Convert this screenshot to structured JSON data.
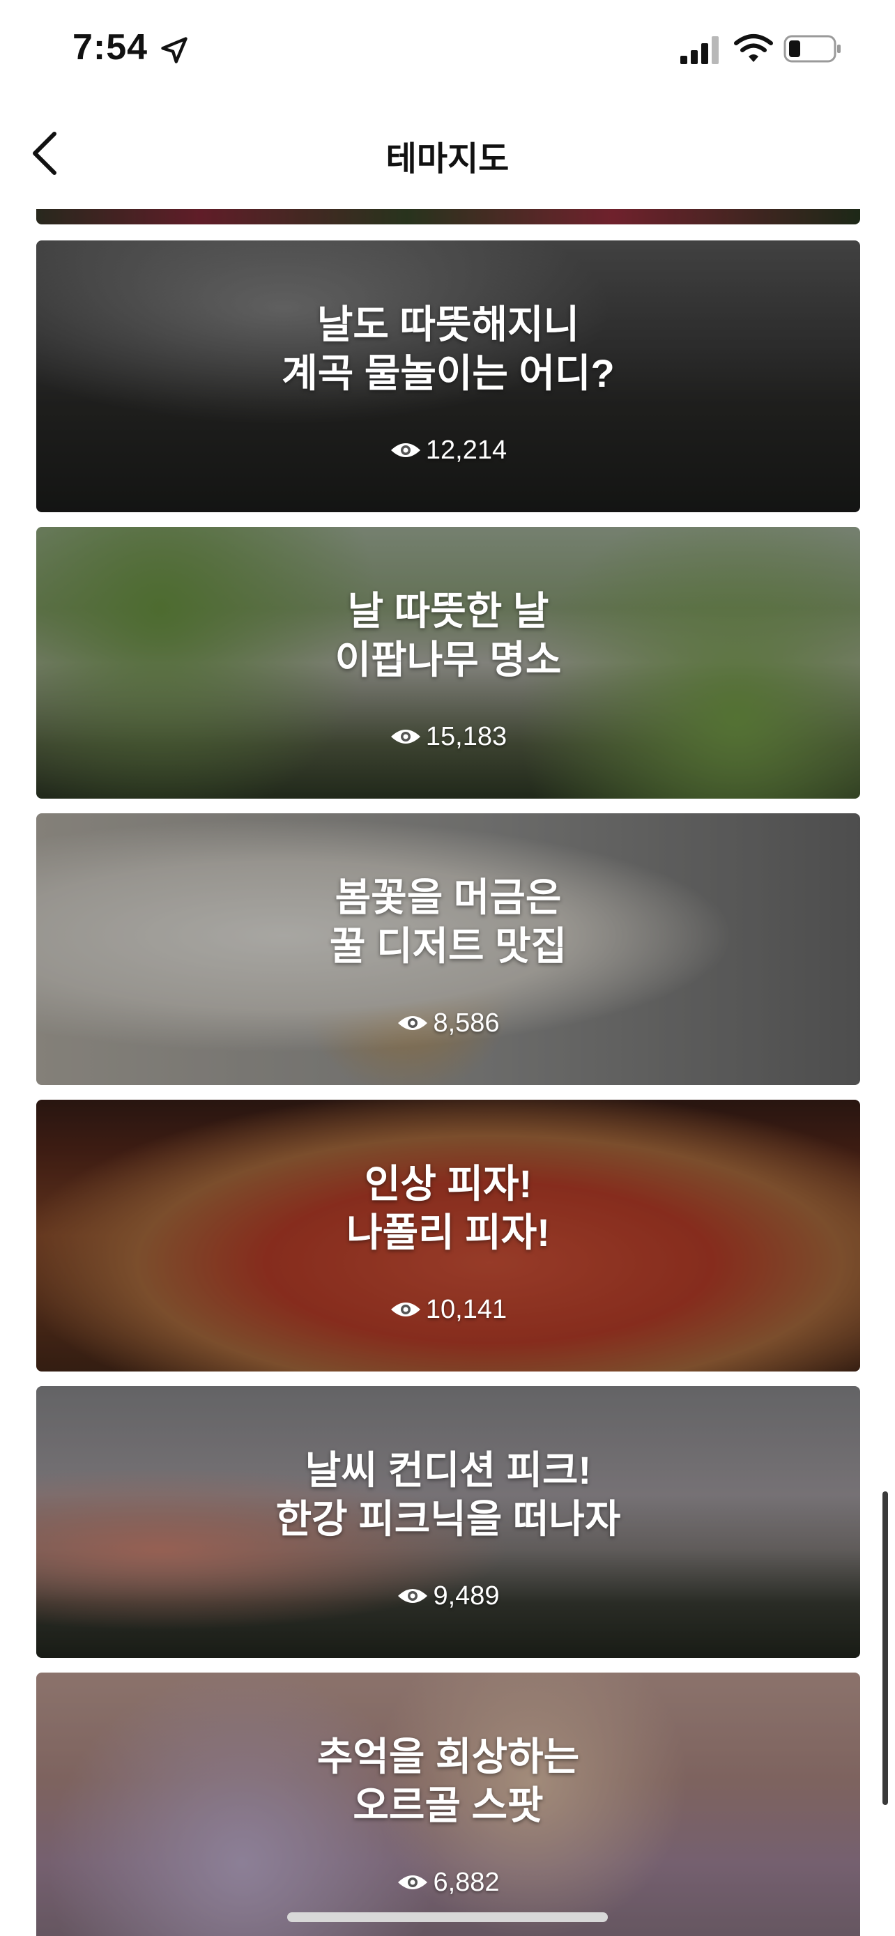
{
  "status_bar": {
    "time": "7:54"
  },
  "nav": {
    "title": "테마지도"
  },
  "colors": {
    "text": "#111111",
    "overlay_text": "#ffffff"
  },
  "cards": [
    {
      "title": "날도 따뜻해지니\n계곡 물놀이는 어디?",
      "views": "12,214",
      "theme": "waterfall"
    },
    {
      "title": "날 따뜻한 날\n이팝나무 명소",
      "views": "15,183",
      "theme": "trees-bridge"
    },
    {
      "title": "봄꽃을 머금은\n꿀 디저트 맛집",
      "views": "8,586",
      "theme": "honey-dessert"
    },
    {
      "title": "인상 피자!\n나폴리 피자!",
      "views": "10,141",
      "theme": "pizza"
    },
    {
      "title": "날씨 컨디션 피크!\n한강 피크닉을 떠나자",
      "views": "9,489",
      "theme": "riverside-sunset"
    },
    {
      "title": "추억을 회상하는\n오르골 스팟",
      "views": "6,882",
      "theme": "music-box"
    }
  ]
}
